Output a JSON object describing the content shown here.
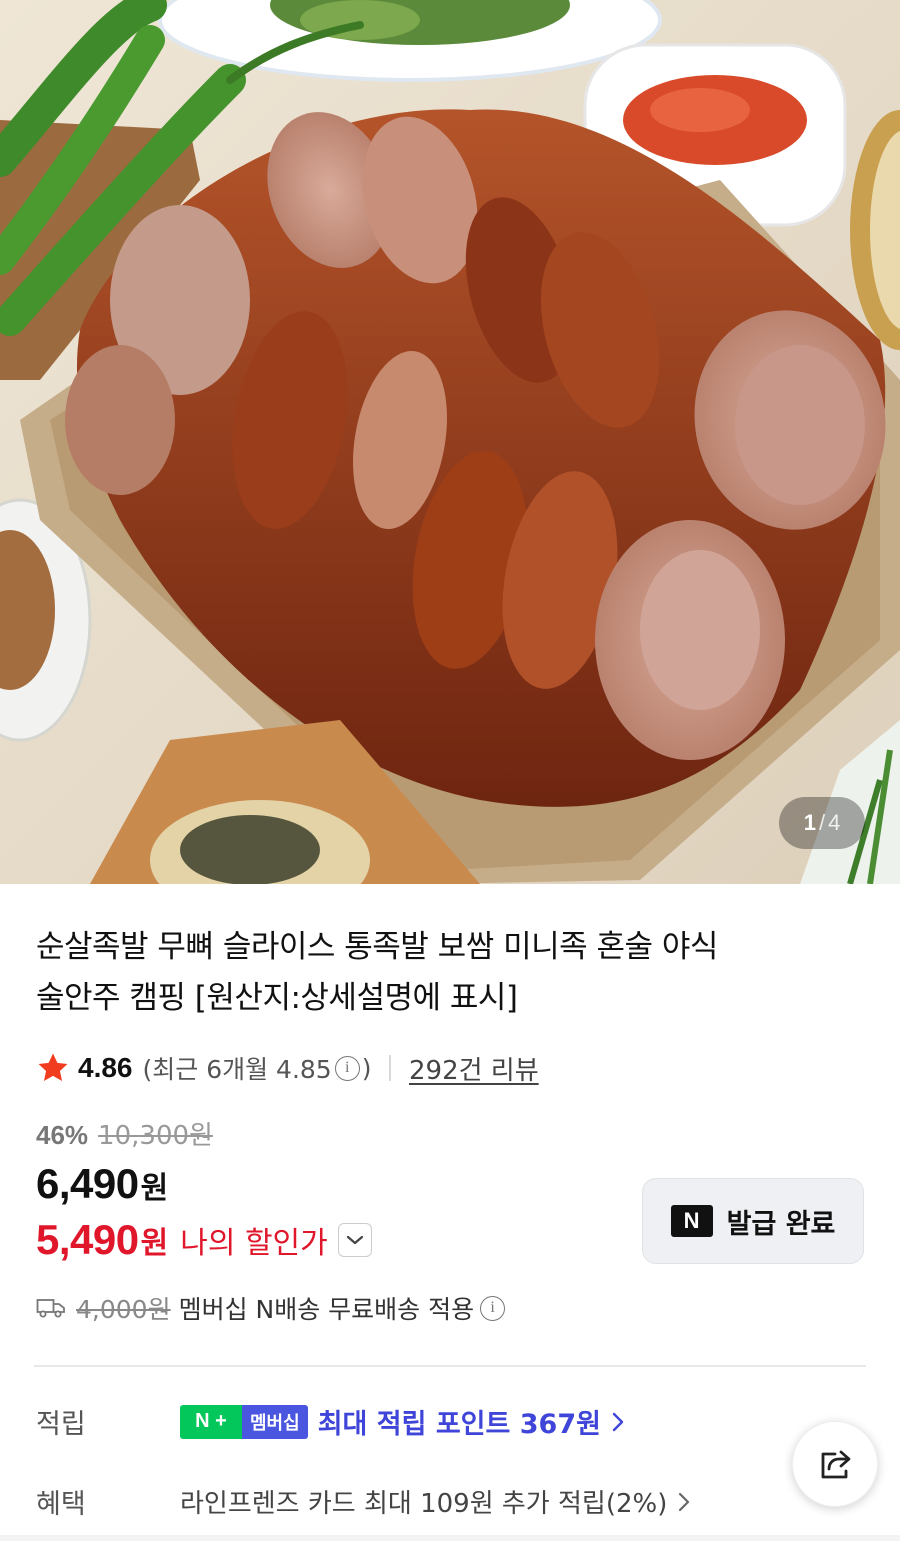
{
  "image_carousel": {
    "current": "1",
    "separator": "/",
    "total": "4"
  },
  "product": {
    "title_line1": "순살족발 무뼈 슬라이스 통족발 보쌈 미니족 혼술 야식",
    "title_line2": "술안주 캠핑 [원산지:상세설명에 표시]"
  },
  "rating": {
    "score": "4.86",
    "recent_prefix": "(최근 6개월 4.85",
    "info_glyph": "i",
    "recent_suffix": ")",
    "review_link": "292건 리뷰"
  },
  "pricing": {
    "discount_rate": "46%",
    "original_price": "10,300원",
    "sale_price": "6,490",
    "sale_unit": "원",
    "my_price": "5,490",
    "my_price_unit": "원",
    "my_price_label": "나의 할인가"
  },
  "coupon": {
    "badge": "N",
    "label": "발급 완료"
  },
  "shipping": {
    "original_fee": "4,000원",
    "text": "멤버십 N배송 무료배송 적용",
    "info_glyph": "i"
  },
  "points": {
    "label": "적립",
    "badge_left": "N + ",
    "badge_right": "멤버십",
    "text": "최대 적립 포인트 367원"
  },
  "benefit": {
    "label": "혜택",
    "text": "라인프렌즈 카드 최대 109원 추가 적립(2%)"
  },
  "colors": {
    "accent_red": "#e0162b",
    "point_blue": "#3f45d8",
    "naver_green": "#03c75a",
    "star": "#f23c20"
  },
  "icons": [
    "star-icon",
    "info-icon",
    "chevron-down-icon",
    "truck-icon",
    "chevron-right-icon",
    "share-icon",
    "naver-n-icon"
  ]
}
